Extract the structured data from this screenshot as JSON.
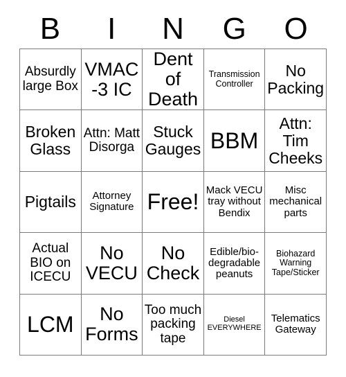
{
  "card": {
    "title": "Bingo Card",
    "header_letters": [
      "B",
      "I",
      "N",
      "G",
      "O"
    ],
    "free_space_label": "Free!",
    "colors": {
      "background": "#ffffff",
      "text": "#000000",
      "grid_line": "#7a7a7a"
    },
    "rows": [
      [
        {
          "text": "Absurdly large Box",
          "size": "m"
        },
        {
          "text": "VMAC-3 IC",
          "size": "xl"
        },
        {
          "text": "Dent of Death",
          "size": "xl"
        },
        {
          "text": "Transmission Controller",
          "size": "xs"
        },
        {
          "text": "No Packing",
          "size": "l"
        }
      ],
      [
        {
          "text": "Broken Glass",
          "size": "l"
        },
        {
          "text": "Attn: Matt Disorga",
          "size": "m"
        },
        {
          "text": "Stuck Gauges",
          "size": "l"
        },
        {
          "text": "BBM",
          "size": "xxl"
        },
        {
          "text": "Attn: Tim Cheeks",
          "size": "l"
        }
      ],
      [
        {
          "text": "Pigtails",
          "size": "l"
        },
        {
          "text": "Attorney Signature",
          "size": "s"
        },
        {
          "text": "Free!",
          "size": "xxl"
        },
        {
          "text": "Mack VECU tray without Bendix",
          "size": "s"
        },
        {
          "text": "Misc mechanical parts",
          "size": "s"
        }
      ],
      [
        {
          "text": "Actual BIO on ICECU",
          "size": "m"
        },
        {
          "text": "No VECU",
          "size": "xl"
        },
        {
          "text": "No Check",
          "size": "xl"
        },
        {
          "text": "Edible/bio-degradable peanuts",
          "size": "s"
        },
        {
          "text": "Biohazard Warning Tape/Sticker",
          "size": "xs"
        }
      ],
      [
        {
          "text": "LCM",
          "size": "xxl"
        },
        {
          "text": "No Forms",
          "size": "xl"
        },
        {
          "text": "Too much packing tape",
          "size": "m"
        },
        {
          "text": "Diesel EVERYWHERE",
          "size": "xxs"
        },
        {
          "text": "Telematics Gateway",
          "size": "s"
        }
      ]
    ]
  }
}
